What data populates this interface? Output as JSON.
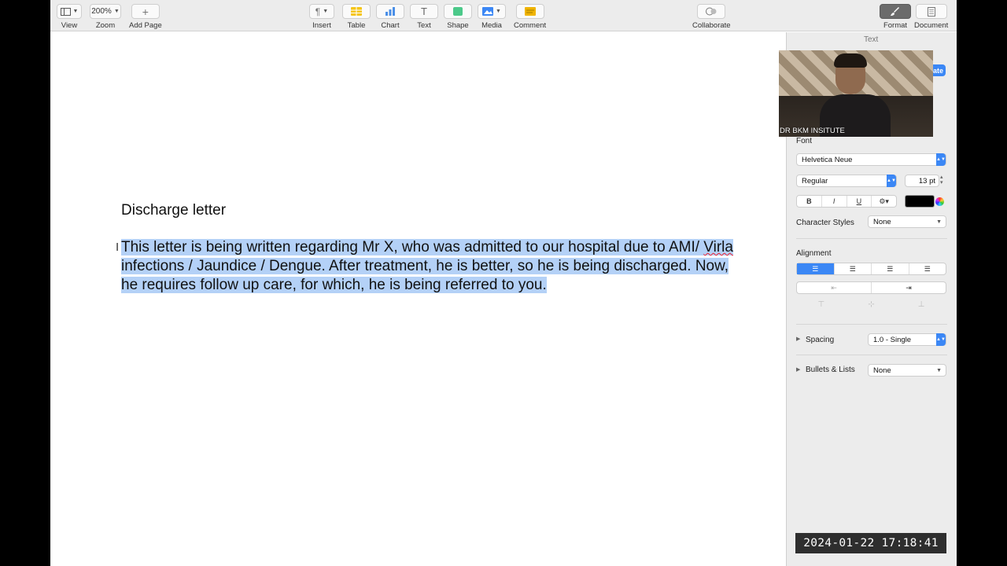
{
  "toolbar": {
    "view": {
      "label": "View",
      "icon": "sidebar-icon"
    },
    "zoom": {
      "label": "Zoom",
      "value": "200%"
    },
    "add_page": {
      "label": "Add Page",
      "icon": "plus-icon"
    },
    "insert": {
      "label": "Insert",
      "icon": "paragraph-icon"
    },
    "table": {
      "label": "Table",
      "icon": "table-icon"
    },
    "chart": {
      "label": "Chart",
      "icon": "chart-icon"
    },
    "text": {
      "label": "Text",
      "icon": "text-box-icon"
    },
    "shape": {
      "label": "Shape",
      "icon": "shape-icon"
    },
    "media": {
      "label": "Media",
      "icon": "image-icon"
    },
    "comment": {
      "label": "Comment",
      "icon": "comment-icon"
    },
    "collaborate": {
      "label": "Collaborate",
      "icon": "collaborate-icon"
    },
    "format": {
      "label": "Format",
      "icon": "paintbrush-icon"
    },
    "document": {
      "label": "Document",
      "icon": "document-icon"
    }
  },
  "document": {
    "title": "Discharge letter",
    "body_part1": "This letter is being written regarding Mr X, who was admitted to our hospital due to AMI/ ",
    "body_misspelled": "Virla",
    "body_part2": " infections / Jaundice / Dengue. After treatment, he is better, so he is being discharged. Now, he requires follow up care, for which, he is being referred to you."
  },
  "inspector": {
    "tab_text": "Text",
    "update_label": "ate",
    "font_heading": "Font",
    "font_family": "Helvetica Neue",
    "font_style": "Regular",
    "font_size": "13 pt",
    "bold": "B",
    "italic": "I",
    "underline": "U",
    "text_color": "#000000",
    "character_styles_label": "Character Styles",
    "character_styles_value": "None",
    "alignment_heading": "Alignment",
    "spacing_label": "Spacing",
    "spacing_value": "1.0 - Single",
    "bullets_label": "Bullets & Lists",
    "bullets_value": "None"
  },
  "video_overlay": {
    "label": "DR BKM INSITUTE"
  },
  "timestamp": "2024-01-22  17:18:41",
  "colors": {
    "accent": "#3b87f5",
    "selection": "#b4d1f7"
  }
}
